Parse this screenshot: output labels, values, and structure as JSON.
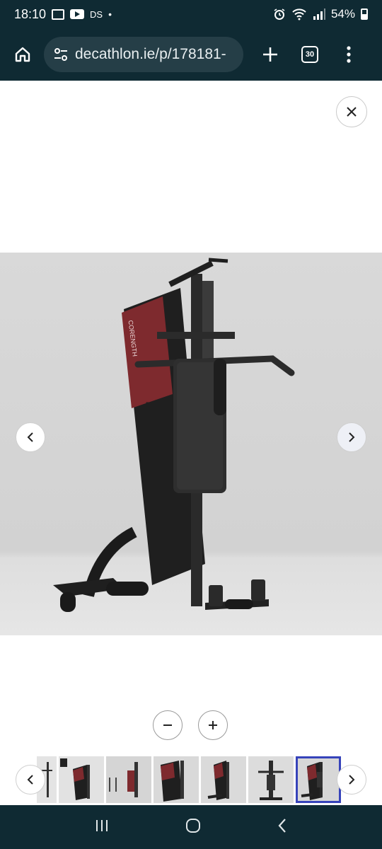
{
  "status_bar": {
    "time": "18:10",
    "ds_label": "DS",
    "dot": "•",
    "battery": "54%",
    "icons": [
      "gallery-icon",
      "youtube-icon",
      "alarm-icon",
      "wifi-icon",
      "signal-icon",
      "battery-icon"
    ]
  },
  "browser": {
    "url": "decathlon.ie/p/178181-",
    "tab_count": "30"
  },
  "gallery": {
    "product_brand": "CORENGTH",
    "thumbnail_count": 7,
    "active_thumbnail_index": 6
  },
  "colors": {
    "chrome_bg": "#0f2a33",
    "url_pill": "#253e47",
    "active_thumb_border": "#3643ba",
    "product_accent": "#8b2a2e"
  }
}
